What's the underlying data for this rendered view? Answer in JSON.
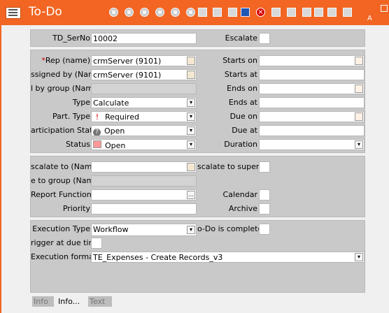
{
  "header": {
    "title": "To-Do",
    "right_letter": "A",
    "toolbar_icons": [
      "first-icon",
      "previous-icon",
      "back-icon",
      "forward-icon",
      "next-icon",
      "last-icon",
      "new-record-icon",
      "edit-icon",
      "copy-icon",
      "save-icon",
      "delete-icon",
      "grid-icon",
      "search-icon",
      "settings-icon",
      "print-icon",
      "close-icon",
      "attachment-icon"
    ]
  },
  "fields": {
    "td_serno_label": "TD_SerNo",
    "td_serno_value": "10002",
    "escalate_label": "Escalate",
    "rep_required_star": "*",
    "rep_label": "Rep (name)",
    "rep_value": "crmServer (9101)",
    "assigned_by_label": "ssigned by (Name)",
    "assigned_by_value": "crmServer (9101)",
    "group_label": "l by group (Name)",
    "type_label": "Type",
    "type_value": "Calculate",
    "part_type_label": "Part. Type",
    "part_type_value": "Required",
    "participation_status_label": "articipation Status",
    "participation_status_value": "Open",
    "status_label": "Status",
    "status_value": "Open",
    "starts_on_label": "Starts on",
    "starts_at_label": "Starts at",
    "ends_on_label": "Ends on",
    "ends_at_label": "Ends at",
    "due_on_label": "Due on",
    "due_at_label": "Due at",
    "duration_label": "Duration",
    "escalate_to_label": "scalate to (Name)",
    "escalate_group_label": "e to group (Name)",
    "escalate_superior_label": "scalate to superior",
    "report_function_label": "Report Function",
    "priority_label": "Priority",
    "calendar_label": "Calendar",
    "archive_label": "Archive",
    "execution_type_label": "Execution Type",
    "execution_type_value": "Workflow",
    "todo_completed_label": "o-Do is completed",
    "trigger_label": "rigger at due time",
    "execution_format_label": "Execution format",
    "execution_format_value": "TE_Expenses - Create Records_v3"
  },
  "tabs": [
    {
      "label": "Info",
      "active": false
    },
    {
      "label": "Info...",
      "active": true
    },
    {
      "label": "Text",
      "active": false
    }
  ],
  "glyphs": {
    "lookup": "…",
    "dropdown": "▾",
    "exclamation": "!",
    "question": "?",
    "delete": "×"
  }
}
